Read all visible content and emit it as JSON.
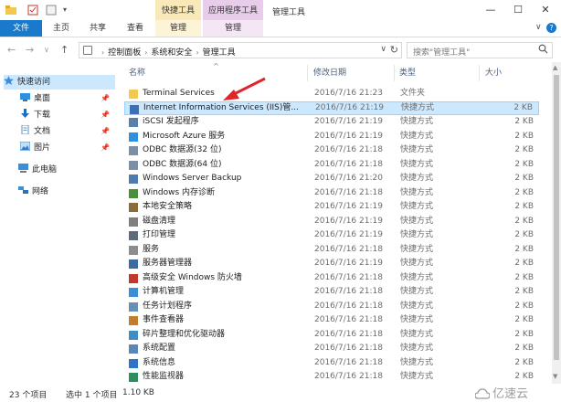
{
  "title_bar": {
    "contextual_tab_manage": "快捷工具",
    "contextual_tab_app": "应用程序工具",
    "window_title": "管理工具",
    "minimize": "—",
    "maximize": "☐",
    "close": "✕"
  },
  "ribbon": {
    "tabs": [
      "文件",
      "主页",
      "共享",
      "查看",
      "管理",
      "管理"
    ],
    "expand": "∨",
    "help": "?"
  },
  "address_bar": {
    "back": "←",
    "forward": "→",
    "recent": "∨",
    "up": "↑",
    "breadcrumbs": [
      "控制面板",
      "系统和安全",
      "管理工具"
    ],
    "dropdown": "∨",
    "refresh": "↻",
    "search_placeholder": "搜索\"管理工具\"",
    "search_icon": "search-icon"
  },
  "navigation": {
    "items": [
      {
        "label": "快速访问",
        "icon": "star-icon",
        "pinned": false
      },
      {
        "label": "桌面",
        "icon": "desktop-icon",
        "pinned": true
      },
      {
        "label": "下载",
        "icon": "download-icon",
        "pinned": true
      },
      {
        "label": "文档",
        "icon": "documents-icon",
        "pinned": true
      },
      {
        "label": "图片",
        "icon": "pictures-icon",
        "pinned": true
      },
      {
        "label": "此电脑",
        "icon": "computer-icon",
        "pinned": false
      },
      {
        "label": "网络",
        "icon": "network-icon",
        "pinned": false
      }
    ]
  },
  "file_list": {
    "columns": [
      "名称",
      "修改日期",
      "类型",
      "大小"
    ],
    "sort_indicator": "^",
    "rows": [
      {
        "name": "Terminal Services",
        "date": "2016/7/16 21:23",
        "type": "文件夹",
        "size": "",
        "icon": "folder-icon"
      },
      {
        "name": "Internet Information Services (IIS)管...",
        "date": "2016/7/16 21:19",
        "type": "快捷方式",
        "size": "2 KB",
        "icon": "iis-icon",
        "selected": true
      },
      {
        "name": "iSCSI 发起程序",
        "date": "2016/7/16 21:19",
        "type": "快捷方式",
        "size": "2 KB",
        "icon": "iscsi-icon"
      },
      {
        "name": "Microsoft Azure 服务",
        "date": "2016/7/16 21:19",
        "type": "快捷方式",
        "size": "2 KB",
        "icon": "azure-icon"
      },
      {
        "name": "ODBC 数据源(32 位)",
        "date": "2016/7/16 21:18",
        "type": "快捷方式",
        "size": "2 KB",
        "icon": "odbc-icon"
      },
      {
        "name": "ODBC 数据源(64 位)",
        "date": "2016/7/16 21:18",
        "type": "快捷方式",
        "size": "2 KB",
        "icon": "odbc-icon"
      },
      {
        "name": "Windows Server Backup",
        "date": "2016/7/16 21:20",
        "type": "快捷方式",
        "size": "2 KB",
        "icon": "backup-icon"
      },
      {
        "name": "Windows 内存诊断",
        "date": "2016/7/16 21:18",
        "type": "快捷方式",
        "size": "2 KB",
        "icon": "memory-icon"
      },
      {
        "name": "本地安全策略",
        "date": "2016/7/16 21:19",
        "type": "快捷方式",
        "size": "2 KB",
        "icon": "policy-icon"
      },
      {
        "name": "磁盘清理",
        "date": "2016/7/16 21:19",
        "type": "快捷方式",
        "size": "2 KB",
        "icon": "disk-icon"
      },
      {
        "name": "打印管理",
        "date": "2016/7/16 21:19",
        "type": "快捷方式",
        "size": "2 KB",
        "icon": "printer-icon"
      },
      {
        "name": "服务",
        "date": "2016/7/16 21:18",
        "type": "快捷方式",
        "size": "2 KB",
        "icon": "services-icon"
      },
      {
        "name": "服务器管理器",
        "date": "2016/7/16 21:19",
        "type": "快捷方式",
        "size": "2 KB",
        "icon": "server-icon"
      },
      {
        "name": "高级安全 Windows 防火墙",
        "date": "2016/7/16 21:18",
        "type": "快捷方式",
        "size": "2 KB",
        "icon": "firewall-icon"
      },
      {
        "name": "计算机管理",
        "date": "2016/7/16 21:18",
        "type": "快捷方式",
        "size": "2 KB",
        "icon": "computer-mgmt-icon"
      },
      {
        "name": "任务计划程序",
        "date": "2016/7/16 21:18",
        "type": "快捷方式",
        "size": "2 KB",
        "icon": "scheduler-icon"
      },
      {
        "name": "事件查看器",
        "date": "2016/7/16 21:18",
        "type": "快捷方式",
        "size": "2 KB",
        "icon": "event-icon"
      },
      {
        "name": "碎片整理和优化驱动器",
        "date": "2016/7/16 21:18",
        "type": "快捷方式",
        "size": "2 KB",
        "icon": "defrag-icon"
      },
      {
        "name": "系统配置",
        "date": "2016/7/16 21:18",
        "type": "快捷方式",
        "size": "2 KB",
        "icon": "config-icon"
      },
      {
        "name": "系统信息",
        "date": "2016/7/16 21:18",
        "type": "快捷方式",
        "size": "2 KB",
        "icon": "info-icon"
      },
      {
        "name": "性能监视器",
        "date": "2016/7/16 21:18",
        "type": "快捷方式",
        "size": "2 KB",
        "icon": "perf-icon"
      }
    ]
  },
  "status_bar": {
    "item_count": "23 个项目",
    "selection": "选中 1 个项目",
    "selection_size": "1.10 KB"
  },
  "watermark": {
    "text": "亿速云"
  },
  "colors": {
    "accent": "#1979ca",
    "selection": "#cce8ff",
    "annotation_arrow": "#e0242a"
  }
}
